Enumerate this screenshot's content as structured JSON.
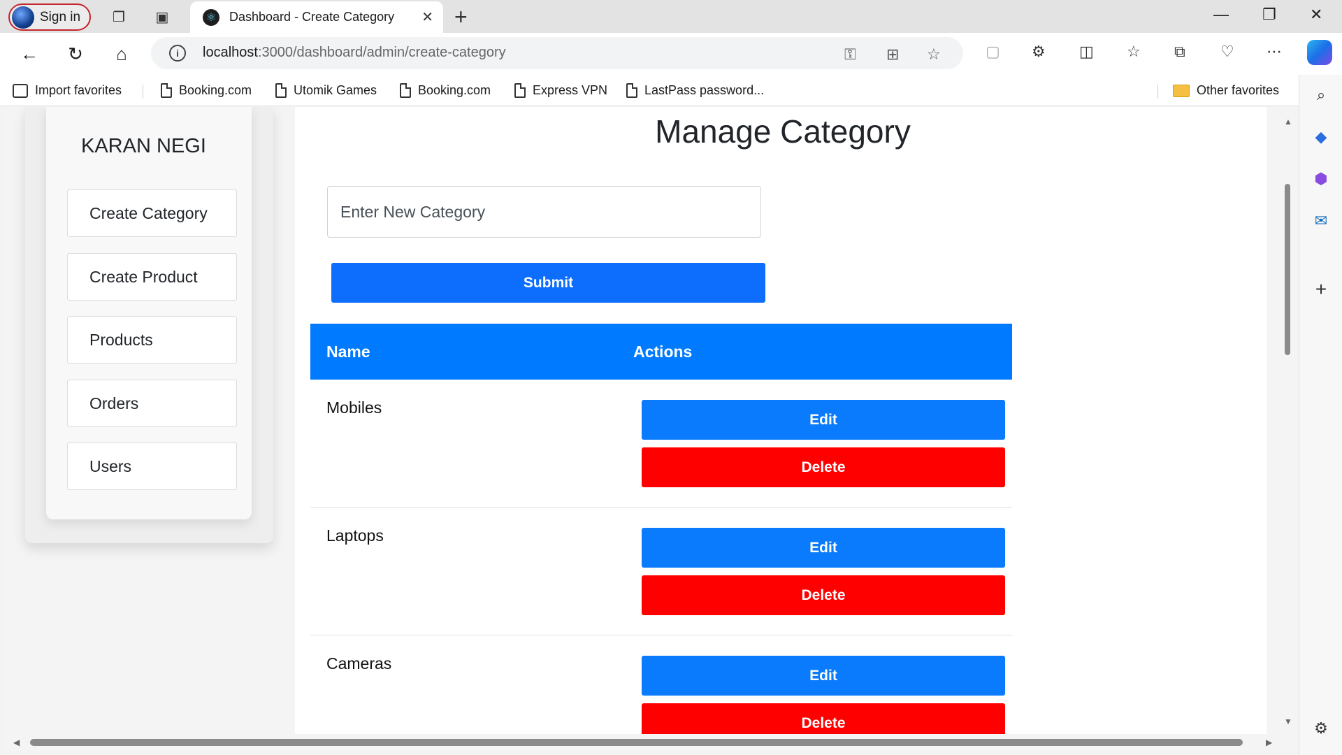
{
  "browser": {
    "signin_label": "Sign in",
    "tab_title": "Dashboard - Create Category",
    "url_host": "localhost",
    "url_path": ":3000/dashboard/admin/create-category",
    "favorites": [
      "Import favorites",
      "Booking.com",
      "Utomik Games",
      "Booking.com",
      "Express VPN",
      "LastPass password..."
    ],
    "other_favorites": "Other favorites"
  },
  "sidebar": {
    "user_name": "KARAN NEGI",
    "links": [
      "Create Category",
      "Create Product",
      "Products",
      "Orders",
      "Users"
    ]
  },
  "main": {
    "title": "Manage Category",
    "input_placeholder": "Enter New Category",
    "submit_label": "Submit",
    "table": {
      "headers": [
        "Name",
        "Actions"
      ],
      "rows": [
        {
          "name": "Mobiles",
          "edit": "Edit",
          "delete": "Delete"
        },
        {
          "name": "Laptops",
          "edit": "Edit",
          "delete": "Delete"
        },
        {
          "name": "Cameras",
          "edit": "Edit",
          "delete": "Delete"
        }
      ]
    }
  },
  "colors": {
    "primary": "#0d6efd",
    "table_header": "#007bff",
    "delete": "#ff0000"
  }
}
